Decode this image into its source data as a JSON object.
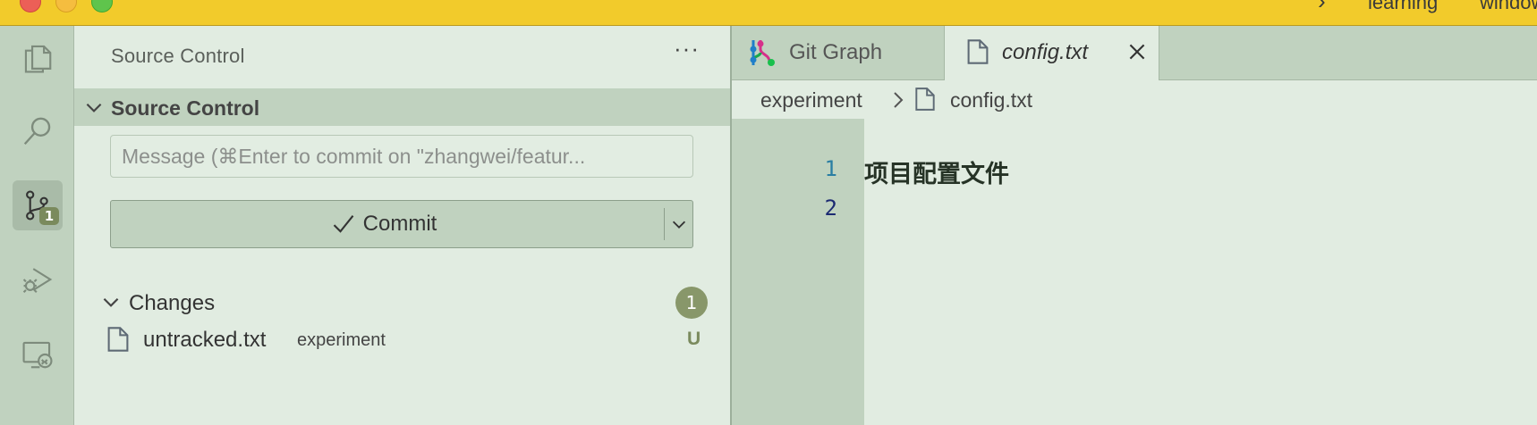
{
  "titlebar": {
    "crumb_sep": "›",
    "crumb_1": "learning",
    "crumb_2": "window"
  },
  "activity_bar": {
    "items": [
      "explorer",
      "search",
      "source-control",
      "run-and-debug",
      "remote-explorer"
    ],
    "active": "source-control",
    "scm_badge": "1"
  },
  "sidebar": {
    "header_title": "Source Control",
    "more_label": "···",
    "section_title": "Source Control",
    "commit_message_placeholder": "Message (⌘Enter to commit on \"zhangwei/featur...",
    "commit_label": "Commit",
    "changes_title": "Changes",
    "changes_count": "1",
    "files": [
      {
        "name": "untracked.txt",
        "path": "experiment",
        "status": "U"
      }
    ]
  },
  "editor": {
    "tabs": [
      {
        "label": "Git Graph",
        "active": false
      },
      {
        "label": "config.txt",
        "active": true
      }
    ],
    "breadcrumb": [
      "experiment",
      "config.txt"
    ],
    "line_numbers": [
      "1",
      "2"
    ],
    "lines": [
      "项目配置文件",
      ""
    ]
  },
  "colors": {
    "titlebar": "#f2cb2b",
    "activity_bar": "#c0d2bf",
    "sidebar_bg": "#e1ece1",
    "badge": "#88976a",
    "status_untracked": "#7a8a5d"
  }
}
